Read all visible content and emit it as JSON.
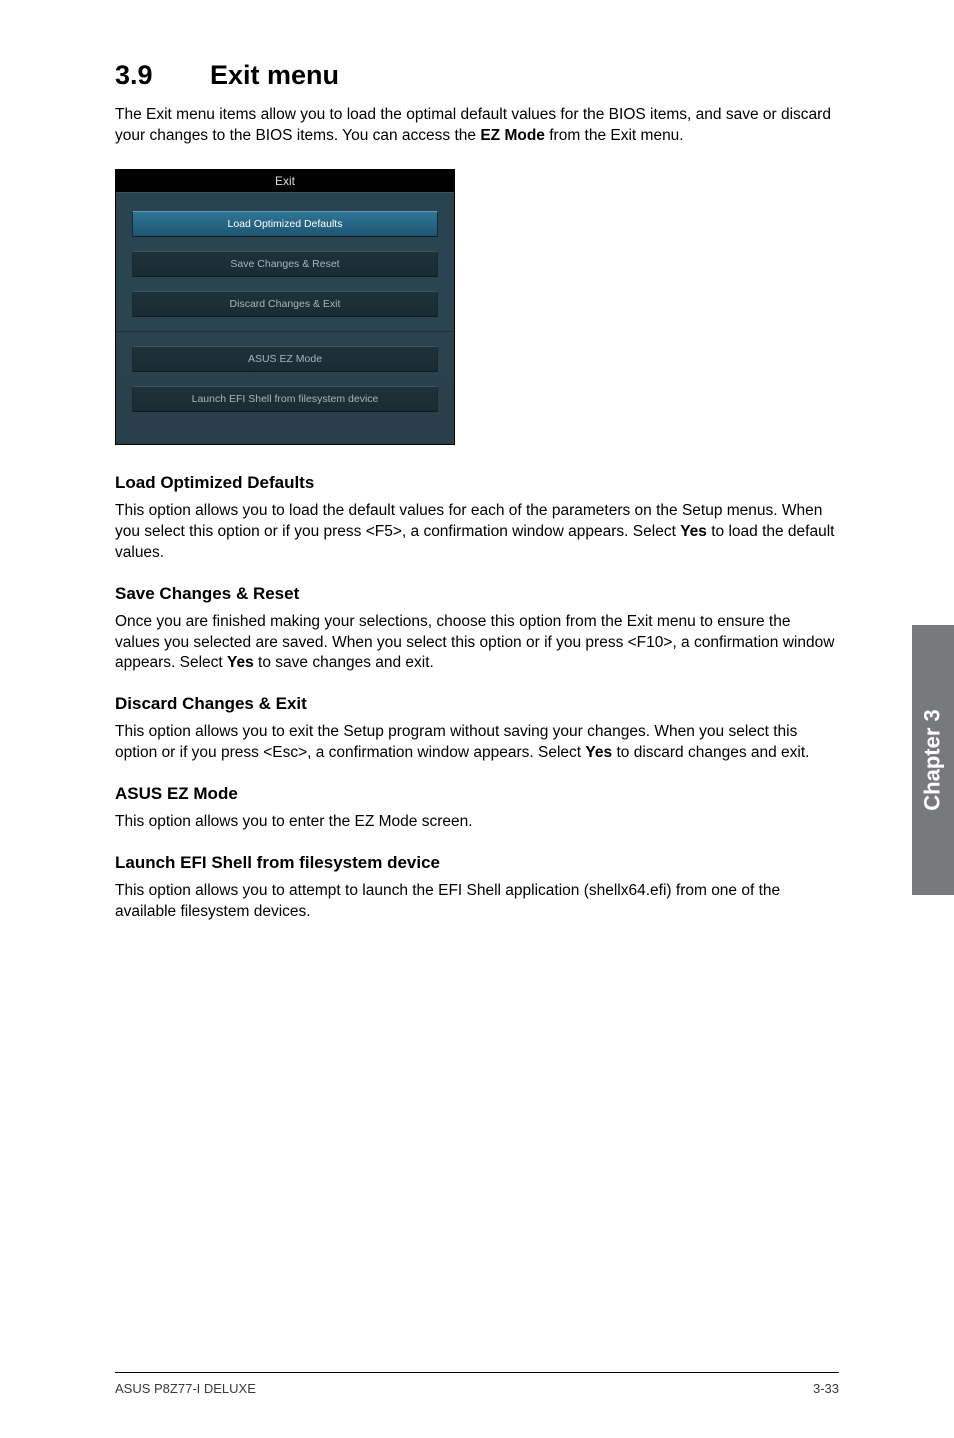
{
  "heading": {
    "num": "3.9",
    "title": "Exit menu"
  },
  "intro_before": "The Exit menu items allow you to load the optimal default values for the BIOS items, and save or discard your changes to the BIOS items. You can access the ",
  "intro_bold": "EZ Mode",
  "intro_after": " from the Exit menu.",
  "bios": {
    "title": "Exit",
    "btn1": "Load Optimized Defaults",
    "btn2": "Save Changes & Reset",
    "btn3": "Discard Changes & Exit",
    "btn4": "ASUS EZ Mode",
    "btn5": "Launch EFI Shell from filesystem device"
  },
  "sections": {
    "s1": {
      "title": "Load Optimized Defaults",
      "pre": "This option allows you to load the default values for each of the parameters on the Setup menus. When you select this option or if you press <F5>, a confirmation window appears. Select ",
      "bold": "Yes",
      "post": " to load the default values."
    },
    "s2": {
      "title": "Save Changes & Reset",
      "pre": "Once you are finished making your selections, choose this option from the Exit menu to ensure the values you selected are saved. When you select this option or if you press <F10>, a confirmation window appears. Select ",
      "bold": "Yes",
      "post": " to save changes and exit."
    },
    "s3": {
      "title": "Discard Changes & Exit",
      "pre": "This option allows you to exit the Setup program without saving your changes. When you select this option or if you press <Esc>, a confirmation window appears. Select ",
      "bold": "Yes",
      "post": " to discard changes and exit."
    },
    "s4": {
      "title": "ASUS EZ Mode",
      "text": "This option allows you to enter the EZ Mode screen."
    },
    "s5": {
      "title": "Launch EFI Shell from filesystem device",
      "text": "This option allows you to attempt to launch the EFI Shell application (shellx64.efi) from one of the available filesystem devices."
    }
  },
  "side_tab": "Chapter 3",
  "footer": {
    "left": "ASUS P8Z77-I DELUXE",
    "right": "3-33"
  }
}
